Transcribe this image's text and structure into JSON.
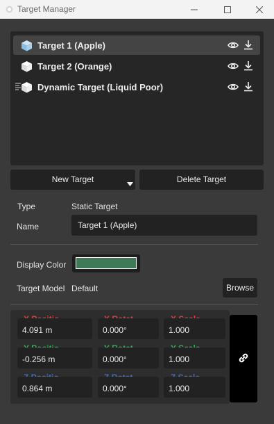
{
  "window": {
    "title": "Target Manager"
  },
  "targets": [
    {
      "label": "Target 1 (Apple)",
      "selected": true,
      "dynamic": false
    },
    {
      "label": "Target 2 (Orange)",
      "selected": false,
      "dynamic": false
    },
    {
      "label": "Dynamic Target (Liquid Poor)",
      "selected": false,
      "dynamic": true
    }
  ],
  "buttons": {
    "new_target": "New Target",
    "delete_target": "Delete Target",
    "browse": "Browse"
  },
  "properties": {
    "type_label": "Type",
    "type_value": "Static Target",
    "name_label": "Name",
    "name_value": "Target 1 (Apple)",
    "display_color_label": "Display Color",
    "display_color_value": "#3f7a56",
    "target_model_label": "Target Model",
    "target_model_value": "Default"
  },
  "transform": {
    "position": {
      "x_label": "X Positio",
      "x_value": "4.091 m",
      "y_label": "Y Positio",
      "y_value": "-0.256 m",
      "z_label": "Z Positio",
      "z_value": "0.864 m"
    },
    "rotation": {
      "x_label": "X Rotat",
      "x_value": "0.000°",
      "y_label": "Y Rotat",
      "y_value": "0.000°",
      "z_label": "Z Rotat",
      "z_value": "0.000°"
    },
    "scale": {
      "x_label": "X Scale",
      "x_value": "1.000",
      "y_label": "Y Scale",
      "y_value": "1.000",
      "z_label": "Z Scale",
      "z_value": "1.000"
    }
  },
  "colors": {
    "x_axis": "#e23b3b",
    "y_axis": "#28b04f",
    "z_axis": "#3d6fc4",
    "background": "#3a3a3a",
    "field": "#222222"
  },
  "icons": {
    "target": "cube-icon",
    "dynamic": "dynamic-indicator-icon",
    "visibility": "eye-icon",
    "download": "download-icon",
    "dropdown": "caret-down-icon",
    "link": "link-icon"
  }
}
